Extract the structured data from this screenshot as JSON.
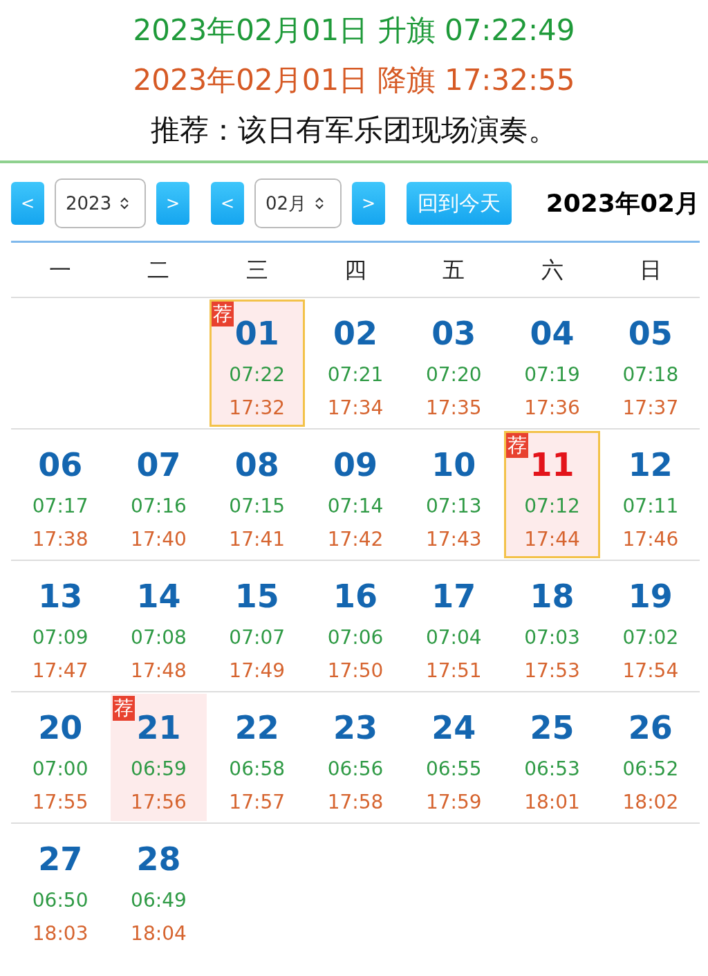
{
  "header": {
    "rise_line": "2023年02月01日 升旗 07:22:49",
    "set_line": "2023年02月01日 降旗 17:32:55",
    "note": "推荐：该日有军乐团现场演奏。"
  },
  "toolbar": {
    "prev_year": "<",
    "year": "2023",
    "next_year": ">",
    "prev_month": "<",
    "month": "02月",
    "next_month": ">",
    "today_button": "回到今天",
    "current": "2023年02月"
  },
  "weekdays": [
    "一",
    "二",
    "三",
    "四",
    "五",
    "六",
    "日"
  ],
  "weeks": [
    {
      "days": [
        {
          "kind": "blank"
        },
        {
          "kind": "blank"
        },
        {
          "kind": "day",
          "date": "01",
          "rise": "07:22",
          "set": "17:32",
          "badge": "荐",
          "recommended": true,
          "outlined": true,
          "holiday": false
        },
        {
          "kind": "day",
          "date": "02",
          "rise": "07:21",
          "set": "17:34",
          "recommended": false,
          "outlined": false,
          "holiday": false
        },
        {
          "kind": "day",
          "date": "03",
          "rise": "07:20",
          "set": "17:35",
          "recommended": false,
          "outlined": false,
          "holiday": false
        },
        {
          "kind": "day",
          "date": "04",
          "rise": "07:19",
          "set": "17:36",
          "recommended": false,
          "outlined": false,
          "holiday": false
        },
        {
          "kind": "day",
          "date": "05",
          "rise": "07:18",
          "set": "17:37",
          "recommended": false,
          "outlined": false,
          "holiday": false
        }
      ]
    },
    {
      "days": [
        {
          "kind": "day",
          "date": "06",
          "rise": "07:17",
          "set": "17:38",
          "recommended": false,
          "outlined": false,
          "holiday": false
        },
        {
          "kind": "day",
          "date": "07",
          "rise": "07:16",
          "set": "17:40",
          "recommended": false,
          "outlined": false,
          "holiday": false
        },
        {
          "kind": "day",
          "date": "08",
          "rise": "07:15",
          "set": "17:41",
          "recommended": false,
          "outlined": false,
          "holiday": false
        },
        {
          "kind": "day",
          "date": "09",
          "rise": "07:14",
          "set": "17:42",
          "recommended": false,
          "outlined": false,
          "holiday": false
        },
        {
          "kind": "day",
          "date": "10",
          "rise": "07:13",
          "set": "17:43",
          "recommended": false,
          "outlined": false,
          "holiday": false
        },
        {
          "kind": "day",
          "date": "11",
          "rise": "07:12",
          "set": "17:44",
          "badge": "荐",
          "recommended": true,
          "outlined": true,
          "holiday": true
        },
        {
          "kind": "day",
          "date": "12",
          "rise": "07:11",
          "set": "17:46",
          "recommended": false,
          "outlined": false,
          "holiday": false
        }
      ]
    },
    {
      "days": [
        {
          "kind": "day",
          "date": "13",
          "rise": "07:09",
          "set": "17:47",
          "recommended": false,
          "outlined": false,
          "holiday": false
        },
        {
          "kind": "day",
          "date": "14",
          "rise": "07:08",
          "set": "17:48",
          "recommended": false,
          "outlined": false,
          "holiday": false
        },
        {
          "kind": "day",
          "date": "15",
          "rise": "07:07",
          "set": "17:49",
          "recommended": false,
          "outlined": false,
          "holiday": false
        },
        {
          "kind": "day",
          "date": "16",
          "rise": "07:06",
          "set": "17:50",
          "recommended": false,
          "outlined": false,
          "holiday": false
        },
        {
          "kind": "day",
          "date": "17",
          "rise": "07:04",
          "set": "17:51",
          "recommended": false,
          "outlined": false,
          "holiday": false
        },
        {
          "kind": "day",
          "date": "18",
          "rise": "07:03",
          "set": "17:53",
          "recommended": false,
          "outlined": false,
          "holiday": false
        },
        {
          "kind": "day",
          "date": "19",
          "rise": "07:02",
          "set": "17:54",
          "recommended": false,
          "outlined": false,
          "holiday": false
        }
      ]
    },
    {
      "days": [
        {
          "kind": "day",
          "date": "20",
          "rise": "07:00",
          "set": "17:55",
          "recommended": false,
          "outlined": false,
          "holiday": false
        },
        {
          "kind": "day",
          "date": "21",
          "rise": "06:59",
          "set": "17:56",
          "badge": "荐",
          "recommended": true,
          "outlined": false,
          "holiday": false
        },
        {
          "kind": "day",
          "date": "22",
          "rise": "06:58",
          "set": "17:57",
          "recommended": false,
          "outlined": false,
          "holiday": false
        },
        {
          "kind": "day",
          "date": "23",
          "rise": "06:56",
          "set": "17:58",
          "recommended": false,
          "outlined": false,
          "holiday": false
        },
        {
          "kind": "day",
          "date": "24",
          "rise": "06:55",
          "set": "17:59",
          "recommended": false,
          "outlined": false,
          "holiday": false
        },
        {
          "kind": "day",
          "date": "25",
          "rise": "06:53",
          "set": "18:01",
          "recommended": false,
          "outlined": false,
          "holiday": false
        },
        {
          "kind": "day",
          "date": "26",
          "rise": "06:52",
          "set": "18:02",
          "recommended": false,
          "outlined": false,
          "holiday": false
        }
      ]
    },
    {
      "days": [
        {
          "kind": "day",
          "date": "27",
          "rise": "06:50",
          "set": "18:03",
          "recommended": false,
          "outlined": false,
          "holiday": false
        },
        {
          "kind": "day",
          "date": "28",
          "rise": "06:49",
          "set": "18:04",
          "recommended": false,
          "outlined": false,
          "holiday": false
        }
      ]
    }
  ]
}
